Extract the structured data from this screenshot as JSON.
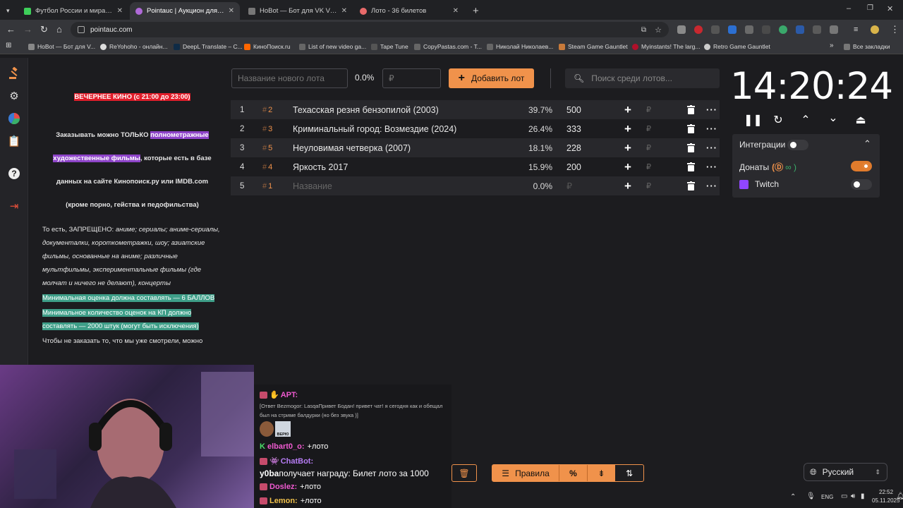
{
  "browser": {
    "tabs": [
      {
        "title": "Футбол России и мира 2025 ...",
        "color": "#3ecf5a",
        "active": false
      },
      {
        "title": "Pointauc | Аукцион для стрим...",
        "color": "#b06ad9",
        "active": true
      },
      {
        "title": "HoBot — Бот для VK Video ...",
        "color": "#999999",
        "active": false
      },
      {
        "title": "Лото - 36 билетов",
        "color": "#e86a6a",
        "active": false
      }
    ],
    "new_tab": "+",
    "url": "pointauc.com",
    "bookmarks": [
      "HoBot — Бот для V...",
      "ReYohoho - онлайн...",
      "DeepL Translate – С...",
      "КиноПоиск.ru",
      "List of new video ga...",
      "Tape Tune",
      "CopyPastas.com - T...",
      "Николай Николаев...",
      "Steam Game Gauntlet",
      "Myinstants! The larg...",
      "Retro Game Gauntlet"
    ],
    "all_bookmarks": "Все закладки"
  },
  "rules": {
    "title": "ВЕЧЕРНЕЕ КИНО (с 21:00 до 23:00)",
    "p1_a": "Заказывать можно ТОЛЬКО ",
    "p1_hl": "полнометражные художественные фильмы",
    "p1_b": ", которые есть в базе данных на сайте Кинопоиск.ру или IMDB.com",
    "p1_c": "(кроме порно, гейства и педофильства)",
    "p2_a": "То есть, ЗАПРЕЩЕНО: ",
    "p2_i": "аниме; сериалы; аниме-сериалы, документалки, короткометражки, шоу; азиатские фильмы, основанные на аниме; различные мультфильмы, экспериментальные фильмы (где молчат и ничего не делают), концерты",
    "p3": "Минимальная оценка должна составлять — 6 БАЛЛОВ",
    "p4": "Минимальное количество оценок на КП должно составлять — 2000 штук (могут быть исключения)",
    "p5": "Чтобы не заказать то, что мы уже смотрели, можно"
  },
  "controls": {
    "lot_placeholder": "Название нового лота",
    "pct": "0.0%",
    "amount_placeholder": "₽",
    "add_label": "Добавить лот",
    "search_placeholder": "Поиск среди лотов..."
  },
  "lots": [
    {
      "n": "1",
      "fast": "2",
      "name": "Техасская резня бензопилой (2003)",
      "pct": "39.7%",
      "amount": "500"
    },
    {
      "n": "2",
      "fast": "3",
      "name": "Криминальный город: Возмездие (2024)",
      "pct": "26.4%",
      "amount": "333"
    },
    {
      "n": "3",
      "fast": "5",
      "name": "Неуловимая четверка (2007)",
      "pct": "18.1%",
      "amount": "228"
    },
    {
      "n": "4",
      "fast": "4",
      "name": "Яркость 2017",
      "pct": "15.9%",
      "amount": "200"
    },
    {
      "n": "5",
      "fast": "1",
      "name": "Название",
      "pct": "0.0%",
      "amount": "₽",
      "placeholder": true
    }
  ],
  "currency": "₽",
  "timer": "14:20:24",
  "integrations": {
    "label": "Интеграции",
    "donations": "Донаты",
    "twitch": "Twitch"
  },
  "chat": {
    "m1_user": "APT:",
    "m1_text": "[Ответ Bezmogor: LasqaПривет Бодан! привет чат! я сегодня как и обещал был на стриме балдурки (но без звука )]",
    "m1_sticker": "ВЕРЮ",
    "m2_user": "elbart0_o:",
    "m2_text": "+лото",
    "m3_user": "ChatBot:",
    "m4_user": "y0ba",
    "m4_text": "получает награду: Билет лото за 1000",
    "m5_user": "Doslez:",
    "m5_text": "+лото",
    "m6_user": "Lemon:",
    "m6_text": "+лото"
  },
  "bottom": {
    "rules_label": "Правила",
    "percent": "%"
  },
  "lang": "Русский",
  "tray": {
    "lang": "ENG",
    "time": "22:52",
    "date": "05.11.2025"
  }
}
